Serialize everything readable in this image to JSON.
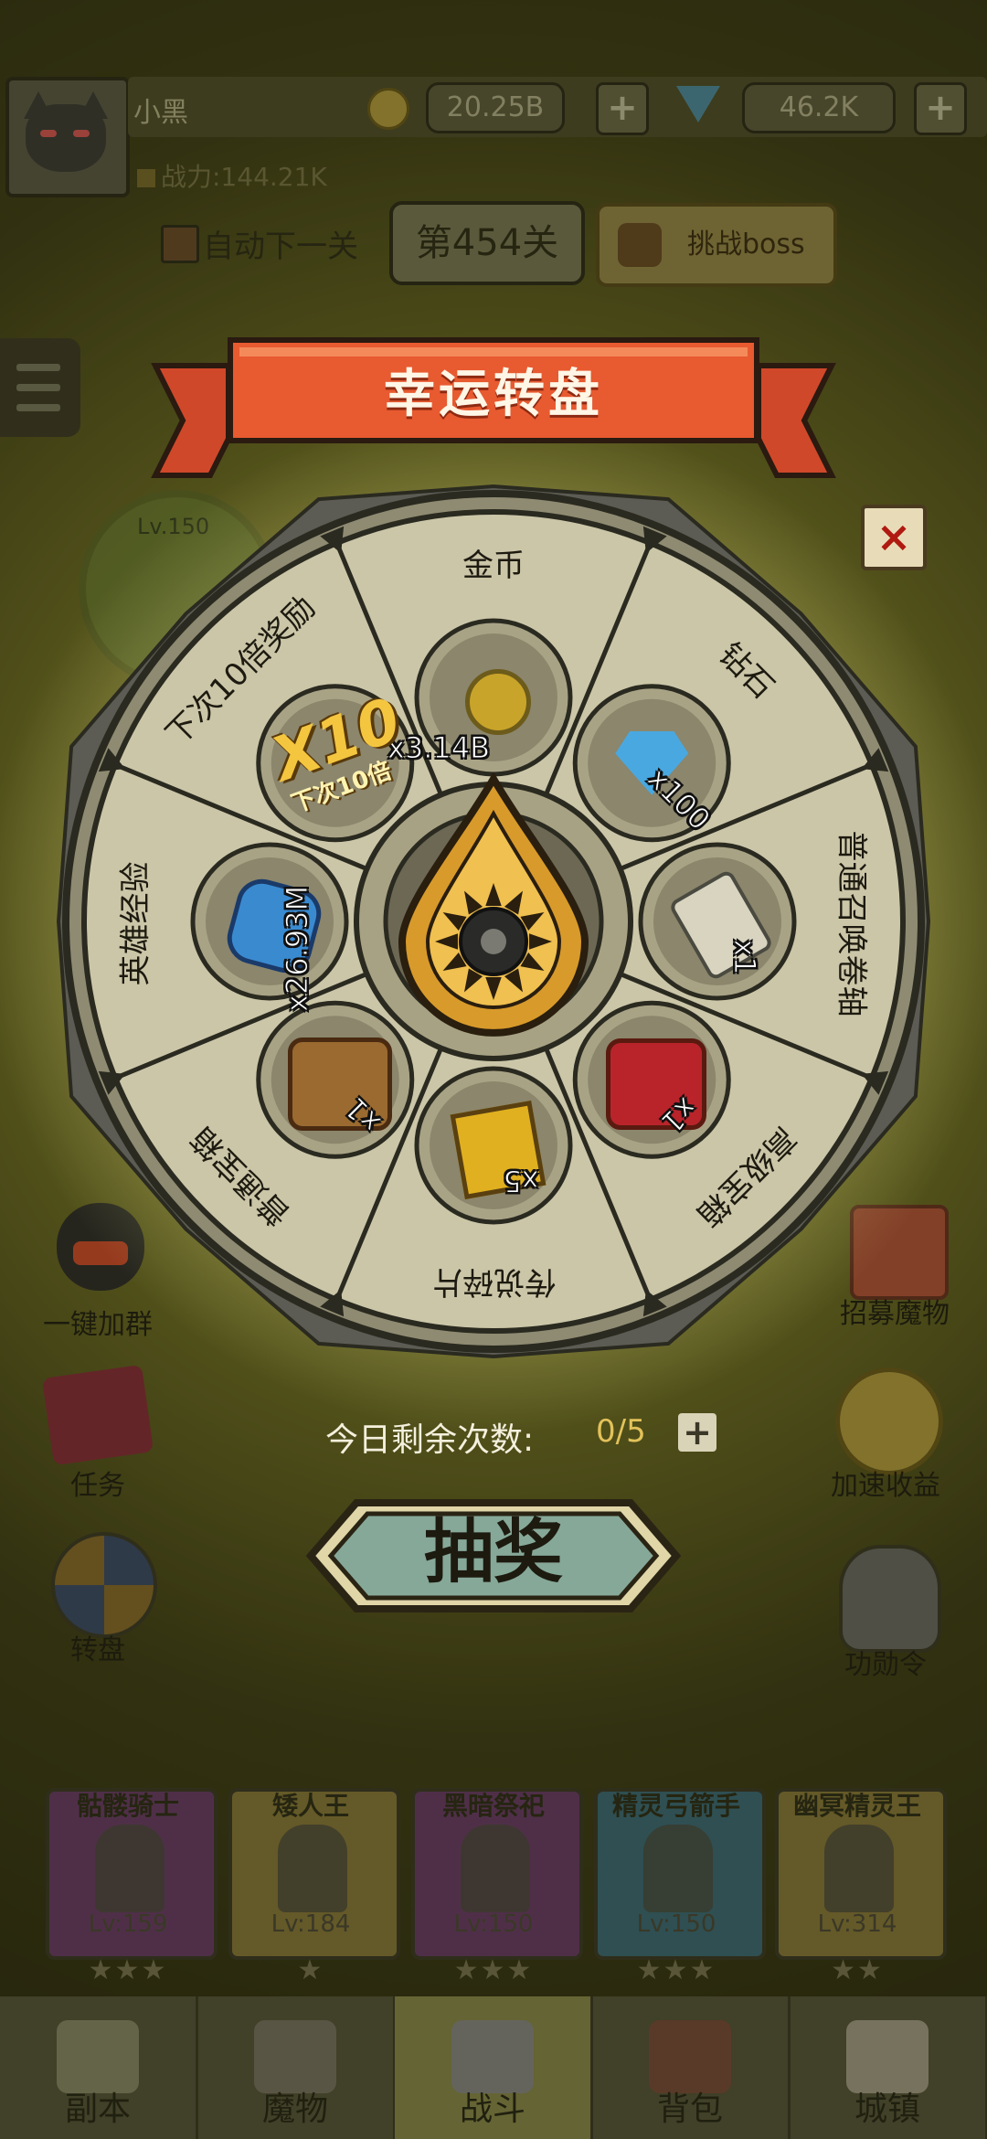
{
  "player": {
    "name": "小黑",
    "power": "战力:144.21K",
    "gold": "20.25B",
    "diamonds": "46.2K",
    "plus": "+"
  },
  "stage": {
    "auto_next": "自动下一关",
    "current": "第454关",
    "boss": "挑战boss"
  },
  "side_left": [
    "一键加群",
    "任务",
    "转盘"
  ],
  "side_right": [
    "招募魔物",
    "加速收益",
    "功勋令"
  ],
  "background_hint": {
    "lv_badge": "Lv.150"
  },
  "heroes": [
    {
      "name": "骷髅骑士",
      "level": "Lv:159",
      "stars": "★★★",
      "color": "#6a3a6a"
    },
    {
      "name": "矮人王",
      "level": "Lv:184",
      "stars": "★",
      "color": "#8a7a3a"
    },
    {
      "name": "黑暗祭祀",
      "level": "Lv:150",
      "stars": "★★★",
      "color": "#6a3a6a"
    },
    {
      "name": "精灵弓箭手",
      "level": "Lv:150",
      "stars": "★★★",
      "color": "#3a6a7a"
    },
    {
      "name": "幽冥精灵王",
      "level": "Lv:314",
      "stars": "★★",
      "color": "#8a7a3a"
    }
  ],
  "nav": [
    {
      "label": "副本",
      "icon": "map-scroll-icon"
    },
    {
      "label": "魔物",
      "icon": "helmet-icon"
    },
    {
      "label": "战斗",
      "icon": "crossed-swords-icon"
    },
    {
      "label": "背包",
      "icon": "backpack-icon"
    },
    {
      "label": "城镇",
      "icon": "town-icon"
    }
  ],
  "wheel": {
    "title": "幸运转盘",
    "close": "×",
    "segments": [
      {
        "label": "金币",
        "qty": "x3.14B",
        "icon": "gold-coin-icon",
        "color": "#c9a42a"
      },
      {
        "label": "钻石",
        "qty": "x100",
        "icon": "diamond-icon",
        "color": "#4aa8e0"
      },
      {
        "label": "普通召唤卷轴",
        "qty": "x1",
        "icon": "summon-scroll-icon",
        "color": "#d8d4c0"
      },
      {
        "label": "高级宝箱",
        "qty": "x1",
        "icon": "red-chest-icon",
        "color": "#b8242a"
      },
      {
        "label": "传说碎片",
        "qty": "x5",
        "icon": "legend-fragment-icon",
        "color": "#e0b020"
      },
      {
        "label": "普通宝箱",
        "qty": "x1",
        "icon": "wood-chest-icon",
        "color": "#9a6a30"
      },
      {
        "label": "英雄经验",
        "qty": "x26.93M",
        "icon": "exp-orb-icon",
        "color": "#3a8ad0"
      },
      {
        "label": "下次10倍奖励",
        "qty": "",
        "icon": "x10-bonus-icon",
        "color": "#e0a830"
      }
    ],
    "bonus_big": "X10",
    "bonus_small": "下次10倍",
    "remaining_label": "今日剩余次数:",
    "remaining_value": "0/5",
    "remaining_plus": "+",
    "draw_button": "抽奖"
  }
}
